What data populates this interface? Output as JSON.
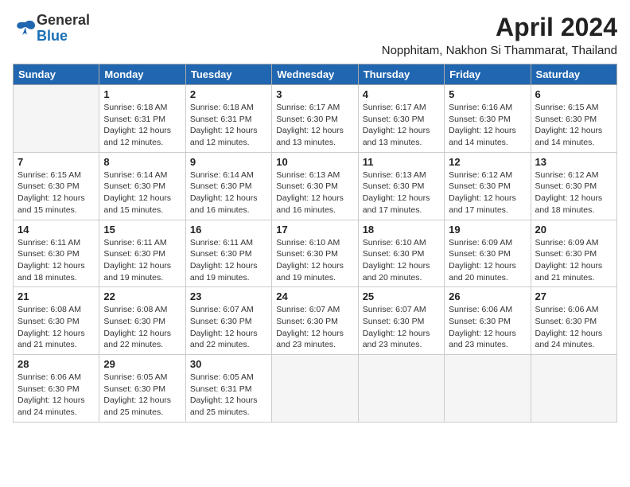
{
  "header": {
    "logo_line1": "General",
    "logo_line2": "Blue",
    "month_year": "April 2024",
    "location": "Nopphitam, Nakhon Si Thammarat, Thailand"
  },
  "weekdays": [
    "Sunday",
    "Monday",
    "Tuesday",
    "Wednesday",
    "Thursday",
    "Friday",
    "Saturday"
  ],
  "weeks": [
    [
      {
        "day": "",
        "sunrise": "",
        "sunset": "",
        "daylight": ""
      },
      {
        "day": "1",
        "sunrise": "Sunrise: 6:18 AM",
        "sunset": "Sunset: 6:31 PM",
        "daylight": "Daylight: 12 hours and 12 minutes."
      },
      {
        "day": "2",
        "sunrise": "Sunrise: 6:18 AM",
        "sunset": "Sunset: 6:31 PM",
        "daylight": "Daylight: 12 hours and 12 minutes."
      },
      {
        "day": "3",
        "sunrise": "Sunrise: 6:17 AM",
        "sunset": "Sunset: 6:30 PM",
        "daylight": "Daylight: 12 hours and 13 minutes."
      },
      {
        "day": "4",
        "sunrise": "Sunrise: 6:17 AM",
        "sunset": "Sunset: 6:30 PM",
        "daylight": "Daylight: 12 hours and 13 minutes."
      },
      {
        "day": "5",
        "sunrise": "Sunrise: 6:16 AM",
        "sunset": "Sunset: 6:30 PM",
        "daylight": "Daylight: 12 hours and 14 minutes."
      },
      {
        "day": "6",
        "sunrise": "Sunrise: 6:15 AM",
        "sunset": "Sunset: 6:30 PM",
        "daylight": "Daylight: 12 hours and 14 minutes."
      }
    ],
    [
      {
        "day": "7",
        "sunrise": "Sunrise: 6:15 AM",
        "sunset": "Sunset: 6:30 PM",
        "daylight": "Daylight: 12 hours and 15 minutes."
      },
      {
        "day": "8",
        "sunrise": "Sunrise: 6:14 AM",
        "sunset": "Sunset: 6:30 PM",
        "daylight": "Daylight: 12 hours and 15 minutes."
      },
      {
        "day": "9",
        "sunrise": "Sunrise: 6:14 AM",
        "sunset": "Sunset: 6:30 PM",
        "daylight": "Daylight: 12 hours and 16 minutes."
      },
      {
        "day": "10",
        "sunrise": "Sunrise: 6:13 AM",
        "sunset": "Sunset: 6:30 PM",
        "daylight": "Daylight: 12 hours and 16 minutes."
      },
      {
        "day": "11",
        "sunrise": "Sunrise: 6:13 AM",
        "sunset": "Sunset: 6:30 PM",
        "daylight": "Daylight: 12 hours and 17 minutes."
      },
      {
        "day": "12",
        "sunrise": "Sunrise: 6:12 AM",
        "sunset": "Sunset: 6:30 PM",
        "daylight": "Daylight: 12 hours and 17 minutes."
      },
      {
        "day": "13",
        "sunrise": "Sunrise: 6:12 AM",
        "sunset": "Sunset: 6:30 PM",
        "daylight": "Daylight: 12 hours and 18 minutes."
      }
    ],
    [
      {
        "day": "14",
        "sunrise": "Sunrise: 6:11 AM",
        "sunset": "Sunset: 6:30 PM",
        "daylight": "Daylight: 12 hours and 18 minutes."
      },
      {
        "day": "15",
        "sunrise": "Sunrise: 6:11 AM",
        "sunset": "Sunset: 6:30 PM",
        "daylight": "Daylight: 12 hours and 19 minutes."
      },
      {
        "day": "16",
        "sunrise": "Sunrise: 6:11 AM",
        "sunset": "Sunset: 6:30 PM",
        "daylight": "Daylight: 12 hours and 19 minutes."
      },
      {
        "day": "17",
        "sunrise": "Sunrise: 6:10 AM",
        "sunset": "Sunset: 6:30 PM",
        "daylight": "Daylight: 12 hours and 19 minutes."
      },
      {
        "day": "18",
        "sunrise": "Sunrise: 6:10 AM",
        "sunset": "Sunset: 6:30 PM",
        "daylight": "Daylight: 12 hours and 20 minutes."
      },
      {
        "day": "19",
        "sunrise": "Sunrise: 6:09 AM",
        "sunset": "Sunset: 6:30 PM",
        "daylight": "Daylight: 12 hours and 20 minutes."
      },
      {
        "day": "20",
        "sunrise": "Sunrise: 6:09 AM",
        "sunset": "Sunset: 6:30 PM",
        "daylight": "Daylight: 12 hours and 21 minutes."
      }
    ],
    [
      {
        "day": "21",
        "sunrise": "Sunrise: 6:08 AM",
        "sunset": "Sunset: 6:30 PM",
        "daylight": "Daylight: 12 hours and 21 minutes."
      },
      {
        "day": "22",
        "sunrise": "Sunrise: 6:08 AM",
        "sunset": "Sunset: 6:30 PM",
        "daylight": "Daylight: 12 hours and 22 minutes."
      },
      {
        "day": "23",
        "sunrise": "Sunrise: 6:07 AM",
        "sunset": "Sunset: 6:30 PM",
        "daylight": "Daylight: 12 hours and 22 minutes."
      },
      {
        "day": "24",
        "sunrise": "Sunrise: 6:07 AM",
        "sunset": "Sunset: 6:30 PM",
        "daylight": "Daylight: 12 hours and 23 minutes."
      },
      {
        "day": "25",
        "sunrise": "Sunrise: 6:07 AM",
        "sunset": "Sunset: 6:30 PM",
        "daylight": "Daylight: 12 hours and 23 minutes."
      },
      {
        "day": "26",
        "sunrise": "Sunrise: 6:06 AM",
        "sunset": "Sunset: 6:30 PM",
        "daylight": "Daylight: 12 hours and 23 minutes."
      },
      {
        "day": "27",
        "sunrise": "Sunrise: 6:06 AM",
        "sunset": "Sunset: 6:30 PM",
        "daylight": "Daylight: 12 hours and 24 minutes."
      }
    ],
    [
      {
        "day": "28",
        "sunrise": "Sunrise: 6:06 AM",
        "sunset": "Sunset: 6:30 PM",
        "daylight": "Daylight: 12 hours and 24 minutes."
      },
      {
        "day": "29",
        "sunrise": "Sunrise: 6:05 AM",
        "sunset": "Sunset: 6:30 PM",
        "daylight": "Daylight: 12 hours and 25 minutes."
      },
      {
        "day": "30",
        "sunrise": "Sunrise: 6:05 AM",
        "sunset": "Sunset: 6:31 PM",
        "daylight": "Daylight: 12 hours and 25 minutes."
      },
      {
        "day": "",
        "sunrise": "",
        "sunset": "",
        "daylight": ""
      },
      {
        "day": "",
        "sunrise": "",
        "sunset": "",
        "daylight": ""
      },
      {
        "day": "",
        "sunrise": "",
        "sunset": "",
        "daylight": ""
      },
      {
        "day": "",
        "sunrise": "",
        "sunset": "",
        "daylight": ""
      }
    ]
  ]
}
